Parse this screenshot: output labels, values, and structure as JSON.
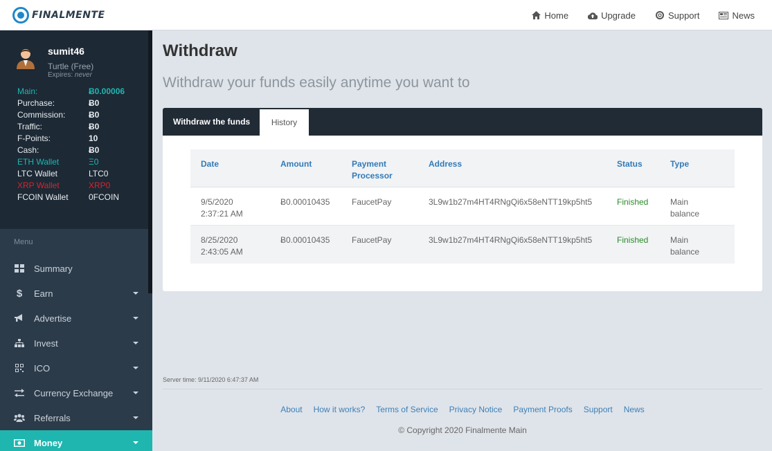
{
  "brand": {
    "name": "FINALMENTE"
  },
  "topnav": [
    {
      "label": "Home",
      "icon": "home-icon"
    },
    {
      "label": "Upgrade",
      "icon": "cloud-upload-icon"
    },
    {
      "label": "Support",
      "icon": "life-ring-icon"
    },
    {
      "label": "News",
      "icon": "newspaper-icon"
    }
  ],
  "user": {
    "name": "sumit46",
    "plan": "Turtle (Free)",
    "expires_label": "Expires:",
    "expires_value": "never"
  },
  "balances": [
    {
      "label": "Main:",
      "value": "Ƀ0.00006",
      "style": "teal"
    },
    {
      "label": "Purchase:",
      "value": "Ƀ0",
      "style": ""
    },
    {
      "label": "Commission:",
      "value": "Ƀ0",
      "style": ""
    },
    {
      "label": "Traffic:",
      "value": "Ƀ0",
      "style": ""
    },
    {
      "label": "F-Points:",
      "value": "10",
      "style": ""
    },
    {
      "label": "Cash:",
      "value": "Ƀ0",
      "style": ""
    },
    {
      "label": "ETH Wallet",
      "value": "Ξ0",
      "style": "teal thin"
    },
    {
      "label": "LTC Wallet",
      "value": "LTC0",
      "style": "thin"
    },
    {
      "label": "XRP Wallet",
      "value": "XRP0",
      "style": "red thin"
    },
    {
      "label": "FCOIN Wallet",
      "value": "0FCOIN",
      "style": "thin"
    }
  ],
  "menu": {
    "title": "Menu",
    "items": [
      {
        "label": "Summary",
        "icon": "dashboard-icon",
        "caret": false
      },
      {
        "label": "Earn",
        "icon": "dollar-icon",
        "caret": true
      },
      {
        "label": "Advertise",
        "icon": "bullhorn-icon",
        "caret": true
      },
      {
        "label": "Invest",
        "icon": "sitemap-icon",
        "caret": true
      },
      {
        "label": "ICO",
        "icon": "qrcode-icon",
        "caret": true
      },
      {
        "label": "Currency Exchange",
        "icon": "exchange-icon",
        "caret": true
      },
      {
        "label": "Referrals",
        "icon": "users-icon",
        "caret": true
      },
      {
        "label": "Money",
        "icon": "money-icon",
        "caret": true,
        "active": true
      }
    ]
  },
  "page": {
    "title": "Withdraw",
    "subtitle": "Withdraw your funds easily anytime you want to"
  },
  "tabs": [
    {
      "label": "Withdraw the funds",
      "active": false
    },
    {
      "label": "History",
      "active": true
    }
  ],
  "history": {
    "columns": [
      "Date",
      "Amount",
      "Payment Processor",
      "Address",
      "Status",
      "Type"
    ],
    "rows": [
      {
        "date": "9/5/2020 2:37:21 AM",
        "amount": "Ƀ0.00010435",
        "processor": "FaucetPay",
        "address": "3L9w1b27m4HT4RNgQi6x58eNTT19kp5ht5",
        "status": "Finished",
        "type": "Main balance"
      },
      {
        "date": "8/25/2020 2:43:05 AM",
        "amount": "Ƀ0.00010435",
        "processor": "FaucetPay",
        "address": "3L9w1b27m4HT4RNgQi6x58eNTT19kp5ht5",
        "status": "Finished",
        "type": "Main balance"
      }
    ]
  },
  "footer": {
    "server_time": "Server time: 9/11/2020 6:47:37 AM",
    "links": [
      "About",
      "How it works?",
      "Terms of Service",
      "Privacy Notice",
      "Payment Proofs",
      "Support",
      "News"
    ],
    "copyright": "© Copyright 2020 Finalmente Main"
  },
  "colors": {
    "accent": "#1fb6b0",
    "sidebar": "#2c3b4a",
    "link": "#337ab7",
    "success": "#2a8a2a",
    "danger": "#d9232d"
  }
}
